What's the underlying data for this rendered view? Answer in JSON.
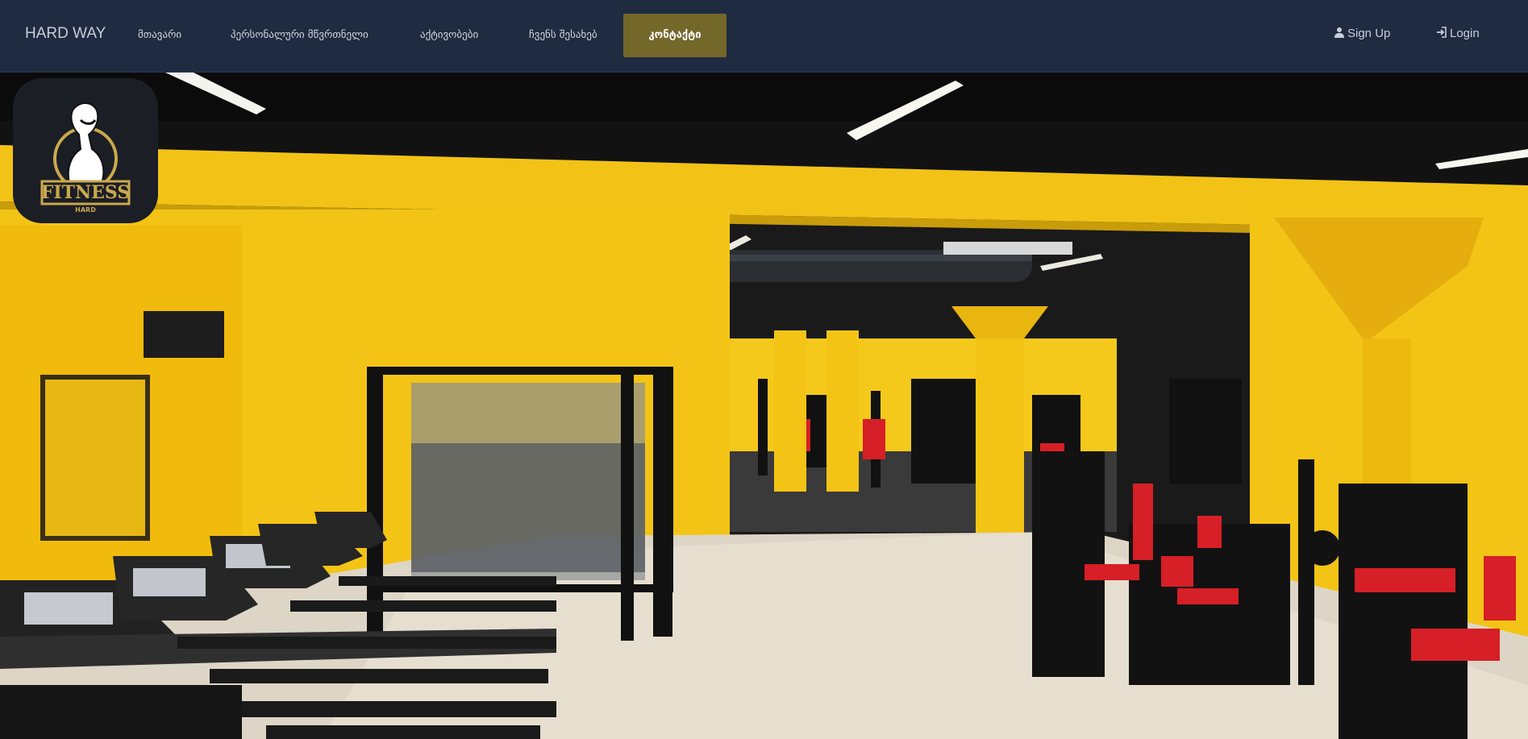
{
  "nav": {
    "brand": "HARD WAY",
    "items": [
      {
        "label": "მთავარი",
        "active": false
      },
      {
        "label": "პერსონალური მწვრთნელი",
        "active": false
      },
      {
        "label": "აქტივობები",
        "active": false
      },
      {
        "label": "ჩვენს შესახებ",
        "active": false
      },
      {
        "label": "კონტაქტი",
        "active": true
      }
    ],
    "signup_label": "Sign Up",
    "login_label": "Login",
    "signup_icon": "user-icon",
    "login_icon": "sign-in-icon"
  },
  "logo": {
    "text": "FITNESS",
    "subtext": "HARD"
  },
  "colors": {
    "navbar_bg": "#1e2b41",
    "active_bg": "#74672a",
    "wall_yellow": "#f3c416",
    "equipment_red": "#d61f26",
    "logo_gold": "#c9a94c"
  }
}
